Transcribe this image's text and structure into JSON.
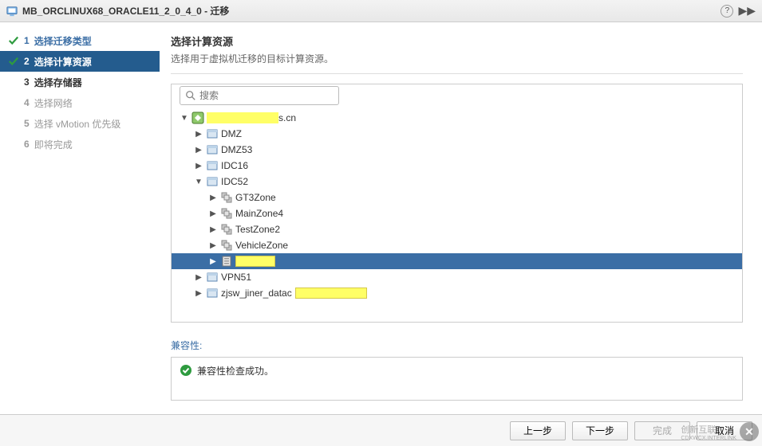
{
  "titlebar": {
    "title": "MB_ORCLINUX68_ORACLE11_2_0_4_0 - 迁移",
    "help_tooltip": "?",
    "expand_glyph": "▶▶"
  },
  "wizard": {
    "steps": [
      {
        "num": "1",
        "label": "选择迁移类型",
        "state": "completed",
        "check": true
      },
      {
        "num": "2",
        "label": "选择计算资源",
        "state": "active",
        "check": true
      },
      {
        "num": "3",
        "label": "选择存储器",
        "state": "next",
        "check": false
      },
      {
        "num": "4",
        "label": "选择网络",
        "state": "future",
        "check": false
      },
      {
        "num": "5",
        "label": "选择 vMotion 优先级",
        "state": "future",
        "check": false
      },
      {
        "num": "6",
        "label": "即将完成",
        "state": "future",
        "check": false
      }
    ]
  },
  "content": {
    "title": "选择计算资源",
    "subtitle": "选择用于虚拟机迁移的目标计算资源。"
  },
  "search": {
    "placeholder": "搜索"
  },
  "tree": {
    "root_suffix": "s.cn",
    "items": [
      {
        "label": "DMZ",
        "indent": 1,
        "type": "datacenter",
        "expandable": true,
        "expanded": false
      },
      {
        "label": "DMZ53",
        "indent": 1,
        "type": "datacenter",
        "expandable": true,
        "expanded": false
      },
      {
        "label": "IDC16",
        "indent": 1,
        "type": "datacenter",
        "expandable": true,
        "expanded": false
      },
      {
        "label": "IDC52",
        "indent": 1,
        "type": "datacenter",
        "expandable": true,
        "expanded": true
      },
      {
        "label": "GT3Zone",
        "indent": 2,
        "type": "cluster",
        "expandable": true,
        "expanded": false
      },
      {
        "label": "MainZone4",
        "indent": 2,
        "type": "cluster",
        "expandable": true,
        "expanded": false
      },
      {
        "label": "TestZone2",
        "indent": 2,
        "type": "cluster",
        "expandable": true,
        "expanded": false
      },
      {
        "label": "VehicleZone",
        "indent": 2,
        "type": "cluster",
        "expandable": true,
        "expanded": false
      },
      {
        "label": "",
        "indent": 2,
        "type": "host",
        "expandable": true,
        "expanded": false,
        "selected": true,
        "redacted": true
      },
      {
        "label": "VPN51",
        "indent": 1,
        "type": "datacenter",
        "expandable": true,
        "expanded": false
      },
      {
        "label": "zjsw_jiner_datac",
        "indent": 1,
        "type": "datacenter",
        "expandable": true,
        "expanded": false,
        "tooltip_redacted": true
      }
    ]
  },
  "compat": {
    "label": "兼容性:",
    "message": "兼容性检查成功。"
  },
  "footer": {
    "back": "上一步",
    "next": "下一步",
    "finish": "完成",
    "cancel": "取消"
  },
  "watermark": {
    "text": "创新互联",
    "sub": "CDXWCX.INTERLINK"
  },
  "icons": {
    "vm": "vm-icon",
    "vcenter": "vcenter-icon",
    "datacenter": "datacenter-icon",
    "cluster": "cluster-icon",
    "host": "host-icon",
    "check": "check-icon",
    "ok": "ok-icon"
  }
}
